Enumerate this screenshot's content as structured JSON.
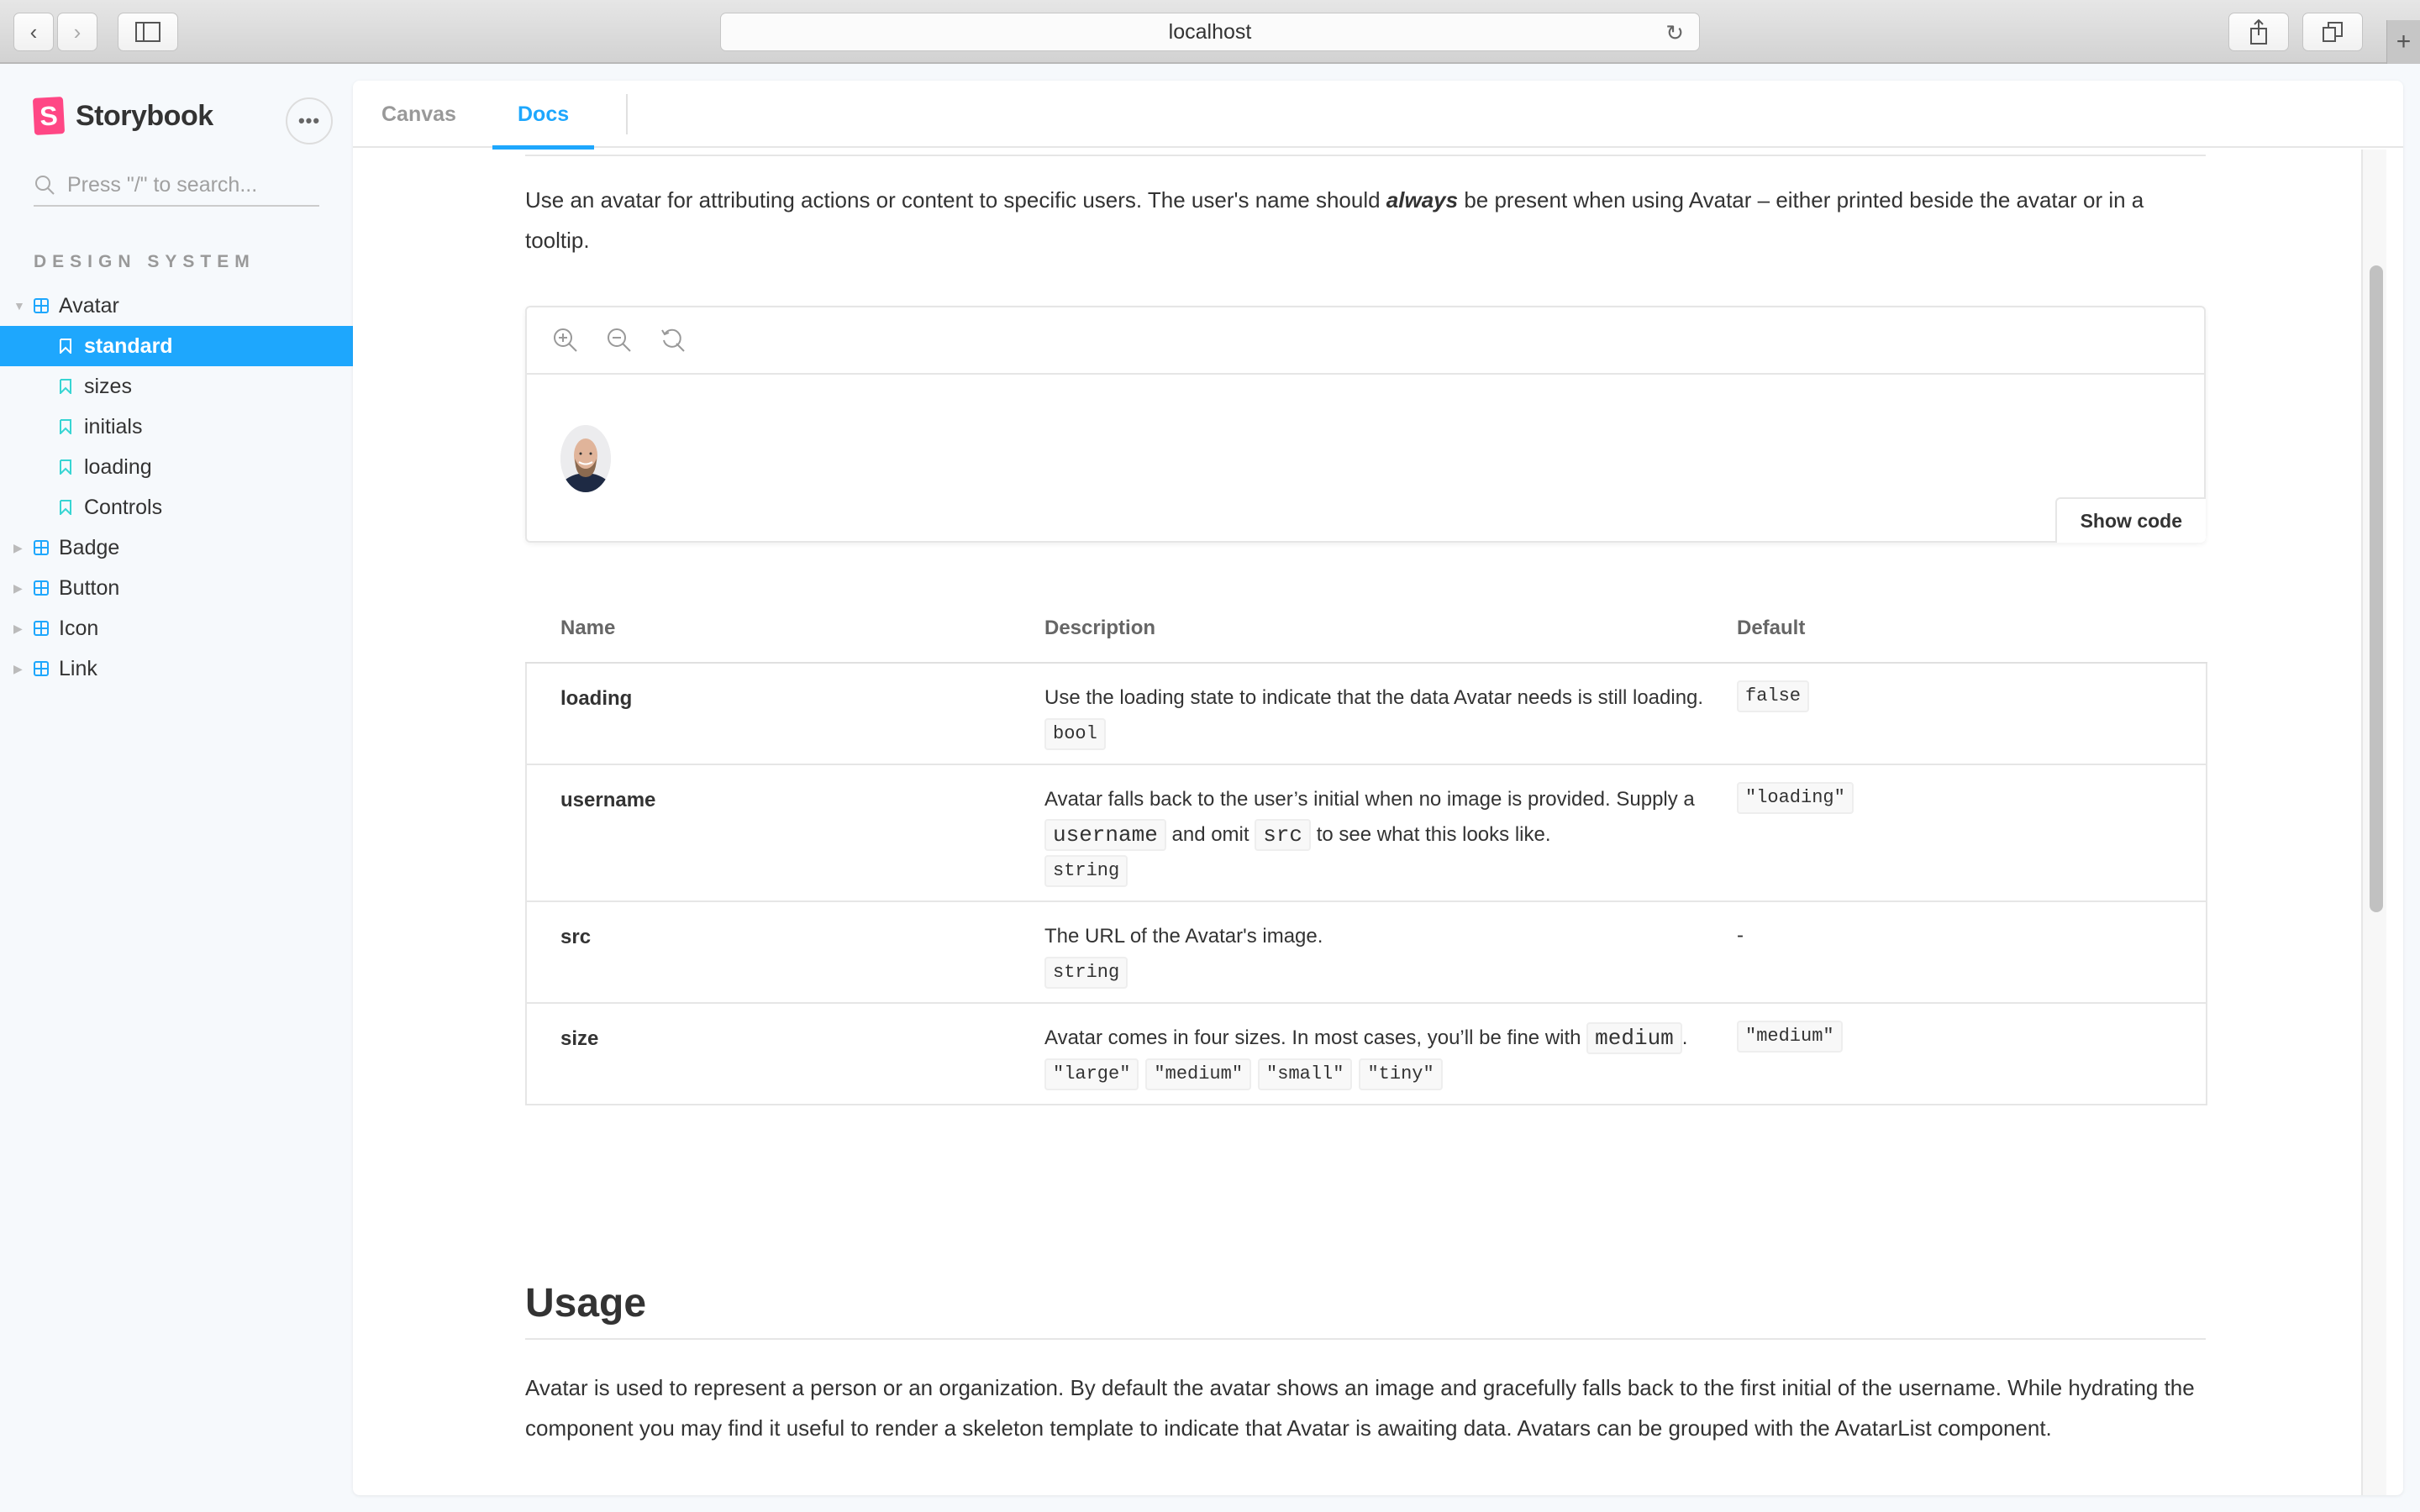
{
  "browser": {
    "url": "localhost",
    "back_label": "‹",
    "forward_label": "›",
    "new_tab_label": "+"
  },
  "sidebar": {
    "brand": "Storybook",
    "brand_logo_letter": "S",
    "menu_label": "•••",
    "search_placeholder": "Press \"/\" to search...",
    "group_title": "DESIGN SYSTEM",
    "items": [
      {
        "label": "Avatar",
        "type": "component",
        "expanded": true
      },
      {
        "label": "standard",
        "type": "story",
        "selected": true
      },
      {
        "label": "sizes",
        "type": "story"
      },
      {
        "label": "initials",
        "type": "story"
      },
      {
        "label": "loading",
        "type": "story"
      },
      {
        "label": "Controls",
        "type": "story"
      },
      {
        "label": "Badge",
        "type": "component"
      },
      {
        "label": "Button",
        "type": "component"
      },
      {
        "label": "Icon",
        "type": "component"
      },
      {
        "label": "Link",
        "type": "component"
      }
    ]
  },
  "tabs": [
    {
      "label": "Canvas",
      "active": false
    },
    {
      "label": "Docs",
      "active": true
    }
  ],
  "docs": {
    "intro_before": "Use an avatar for attributing actions or content to specific users. The user's name should ",
    "intro_emphasis": "always",
    "intro_after": " be present when using Avatar – either printed beside the avatar or in a tooltip.",
    "preview": {
      "show_code_label": "Show code",
      "toolbar": [
        "zoom-in",
        "zoom-out",
        "zoom-reset"
      ]
    },
    "props_table": {
      "headers": {
        "name": "Name",
        "description": "Description",
        "default": "Default"
      },
      "rows": [
        {
          "name": "loading",
          "description": "Use the loading state to indicate that the data Avatar needs is still loading.",
          "types": [
            "bool"
          ],
          "default": "false"
        },
        {
          "name": "username",
          "description_parts": [
            "Avatar falls back to the user’s initial when no image is provided. Supply a ",
            "username",
            " and omit ",
            "src",
            " to see what this looks like."
          ],
          "types": [
            "string"
          ],
          "default": "\"loading\""
        },
        {
          "name": "src",
          "description": "The URL of the Avatar's image.",
          "types": [
            "string"
          ],
          "default": "-"
        },
        {
          "name": "size",
          "description_parts": [
            "Avatar comes in four sizes. In most cases, you’ll be fine with ",
            "medium",
            "."
          ],
          "types": [
            "\"large\"",
            "\"medium\"",
            "\"small\"",
            "\"tiny\""
          ],
          "default": "\"medium\""
        }
      ]
    },
    "usage": {
      "heading": "Usage",
      "paragraph": "Avatar is used to represent a person or an organization. By default the avatar shows an image and gracefully falls back to the first initial of the username. While hydrating the component you may find it useful to render a skeleton template to indicate that Avatar is awaiting data. Avatars can be grouped with the AvatarList component."
    }
  },
  "colors": {
    "accent": "#1ea7fd",
    "brand": "#ff4785",
    "story_icon": "#37d5d3"
  }
}
